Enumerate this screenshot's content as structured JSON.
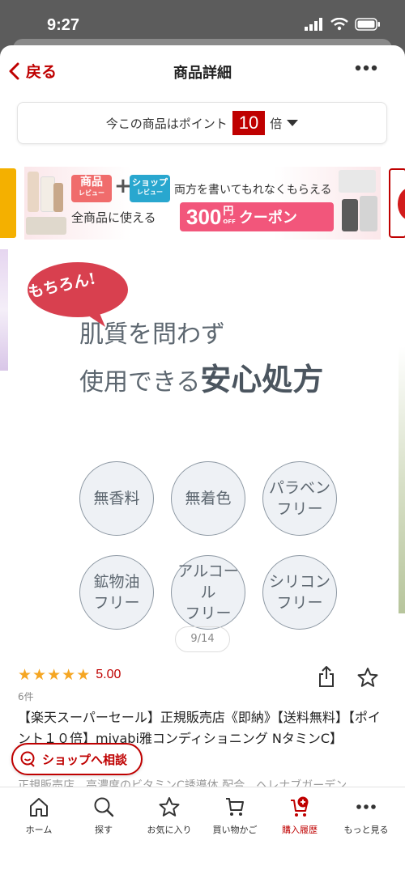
{
  "status_bar": {
    "time": "9:27"
  },
  "nav": {
    "back_label": "戻る",
    "title": "商品詳細"
  },
  "points": {
    "prefix": "今この商品はポイント",
    "multiplier": "10",
    "suffix": "倍"
  },
  "banner": {
    "badge_product": "商品",
    "badge_product_sub": "レビュー",
    "plus": "+",
    "badge_shop": "ショップ",
    "badge_shop_sub": "レビュー",
    "line1": "両方を書いてもれなくもらえる",
    "line2": "全商品に使える",
    "coupon_amount": "300",
    "coupon_yen": "円",
    "coupon_off": "OFF",
    "coupon_label": "クーポン"
  },
  "product_image": {
    "speech": "もちろん!",
    "headline1": "肌質を問わず",
    "headline2_prefix": "使用できる",
    "headline2_strong": "安心処方",
    "features": [
      {
        "line1": "無香料",
        "line2": ""
      },
      {
        "line1": "無着色",
        "line2": ""
      },
      {
        "line1": "パラベン",
        "line2": "フリー"
      },
      {
        "line1": "鉱物油",
        "line2": "フリー"
      },
      {
        "line1": "アルコール",
        "line2": "フリー"
      },
      {
        "line1": "シリコン",
        "line2": "フリー"
      }
    ]
  },
  "pager": {
    "text": "9/14"
  },
  "rating": {
    "value": "5.00",
    "stars": 5,
    "review_count": "6件"
  },
  "product": {
    "title": "【楽天スーパーセール】正規販売店《即納》【送料無料】【ポイント１０倍】miyabi雅コンディショニング NタミンC】",
    "subtitle": "正規販売店　高濃度のビタミンC誘導体 配合　ヘレナブガーデン"
  },
  "consult_button": "ショップへ相談",
  "tabbar": {
    "items": [
      {
        "label": "ホーム",
        "icon": "home-icon"
      },
      {
        "label": "探す",
        "icon": "search-icon"
      },
      {
        "label": "お気に入り",
        "icon": "star-icon"
      },
      {
        "label": "買い物かご",
        "icon": "cart-icon"
      },
      {
        "label": "購入履歴",
        "icon": "purchase-history-icon"
      },
      {
        "label": "もっと見る",
        "icon": "more-icon"
      }
    ]
  },
  "colors": {
    "accent": "#bf0000",
    "star": "#f5a623",
    "coupon": "#f2567b"
  }
}
